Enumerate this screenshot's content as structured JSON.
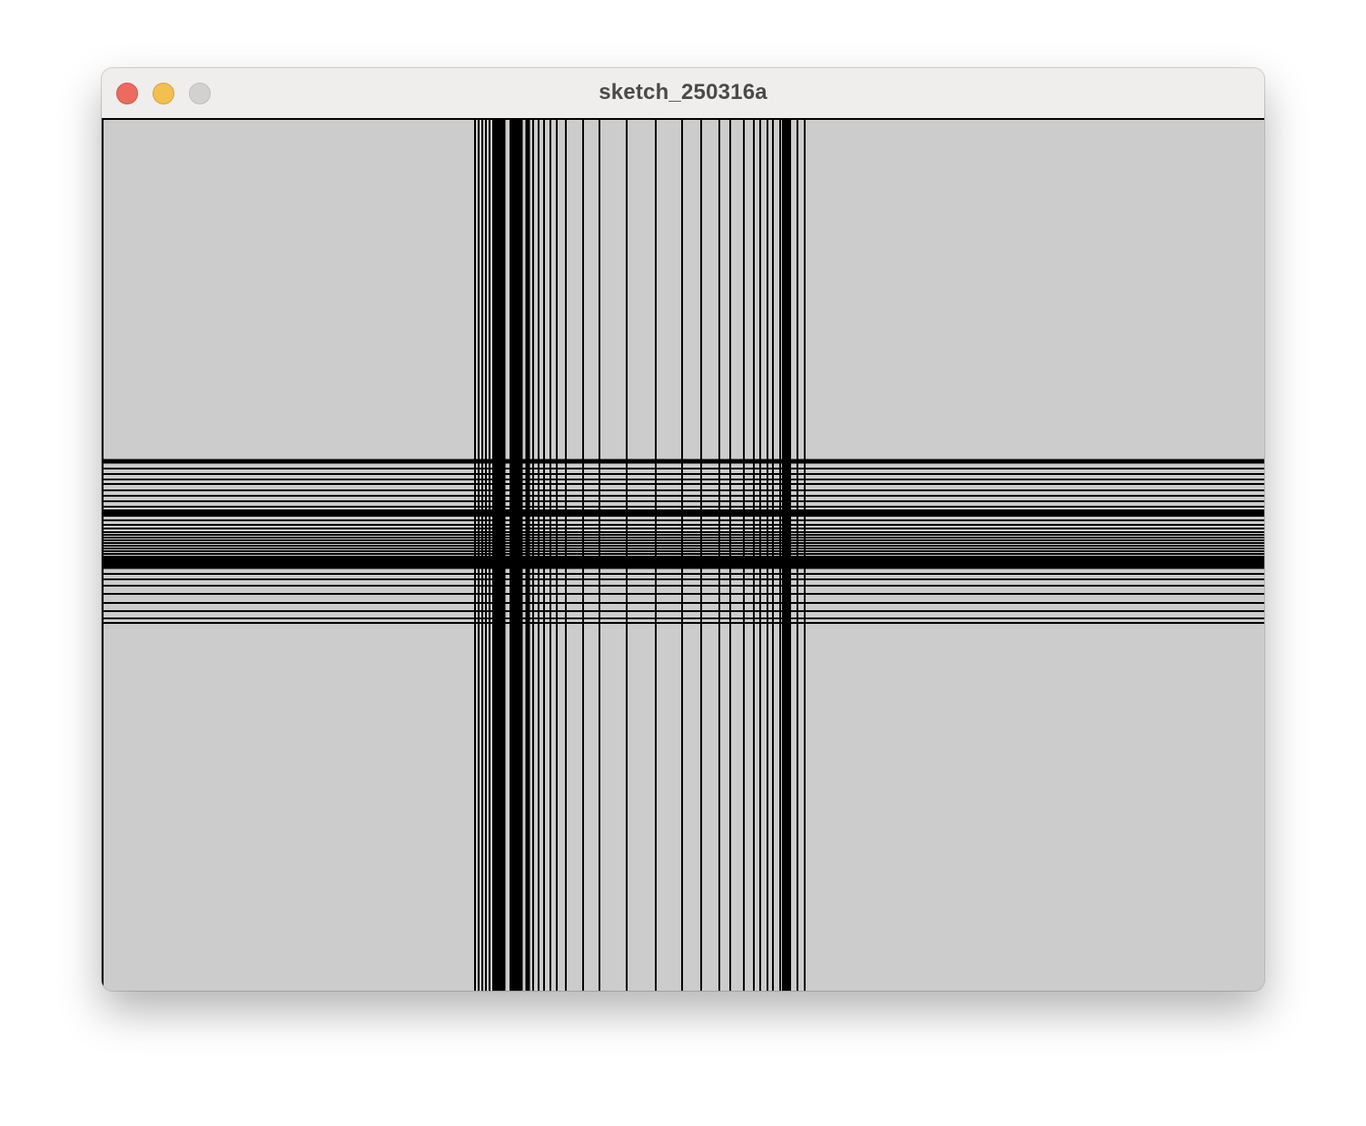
{
  "window": {
    "title": "sketch_250316a"
  },
  "colors": {
    "canvas_background": "#cccccc",
    "line_color": "#000000",
    "titlebar": "#efeeec",
    "close": "#ec6a5e",
    "minimize": "#f5bf4f",
    "maximize": "#d2d1cf"
  }
}
